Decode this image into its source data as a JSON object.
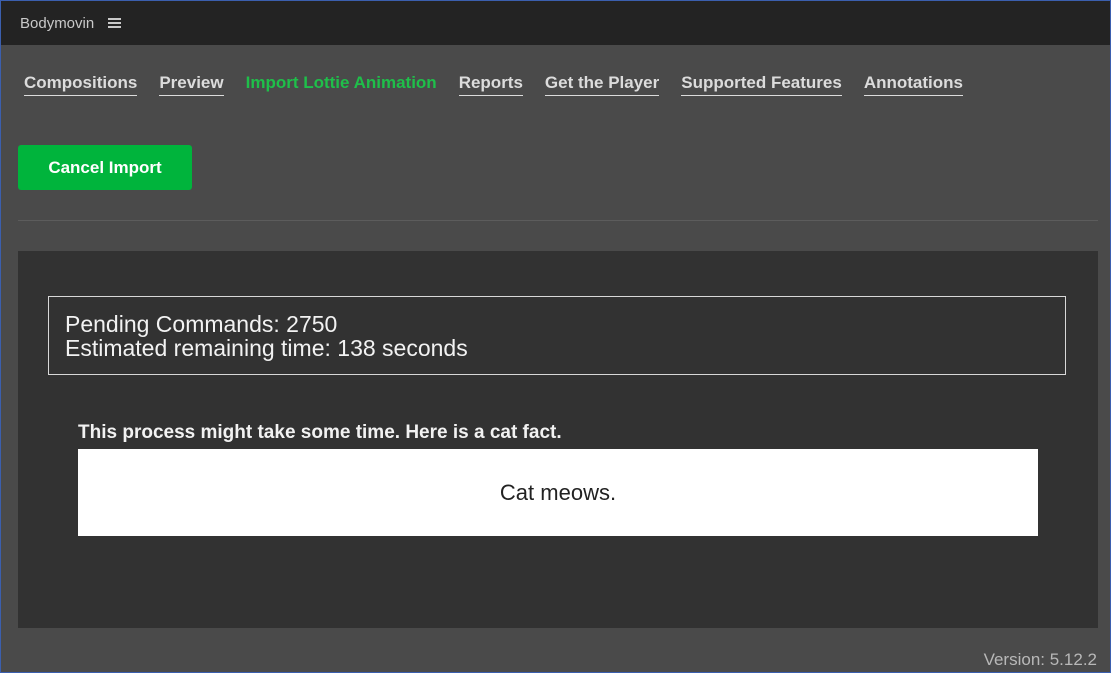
{
  "app": {
    "title": "Bodymovin",
    "menu_icon": "hamburger-menu-icon"
  },
  "nav": {
    "items": [
      {
        "label": "Compositions",
        "active": false
      },
      {
        "label": "Preview",
        "active": false
      },
      {
        "label": "Import Lottie Animation",
        "active": true
      },
      {
        "label": "Reports",
        "active": false
      },
      {
        "label": "Get the Player",
        "active": false
      },
      {
        "label": "Supported Features",
        "active": false
      },
      {
        "label": "Annotations",
        "active": false
      }
    ]
  },
  "actions": {
    "cancel_label": "Cancel Import"
  },
  "status": {
    "pending": "Pending Commands: 2750",
    "remaining": "Estimated remaining time: 138 seconds"
  },
  "fact": {
    "heading": "This process might take some time. Here is a cat fact.",
    "text": "Cat meows."
  },
  "footer": {
    "version": "Version: 5.12.2"
  },
  "colors": {
    "accent": "#00b43c",
    "active_nav": "#1fbf4a",
    "background": "#4a4a4a",
    "panel": "#323232",
    "titlebar": "#232323"
  }
}
